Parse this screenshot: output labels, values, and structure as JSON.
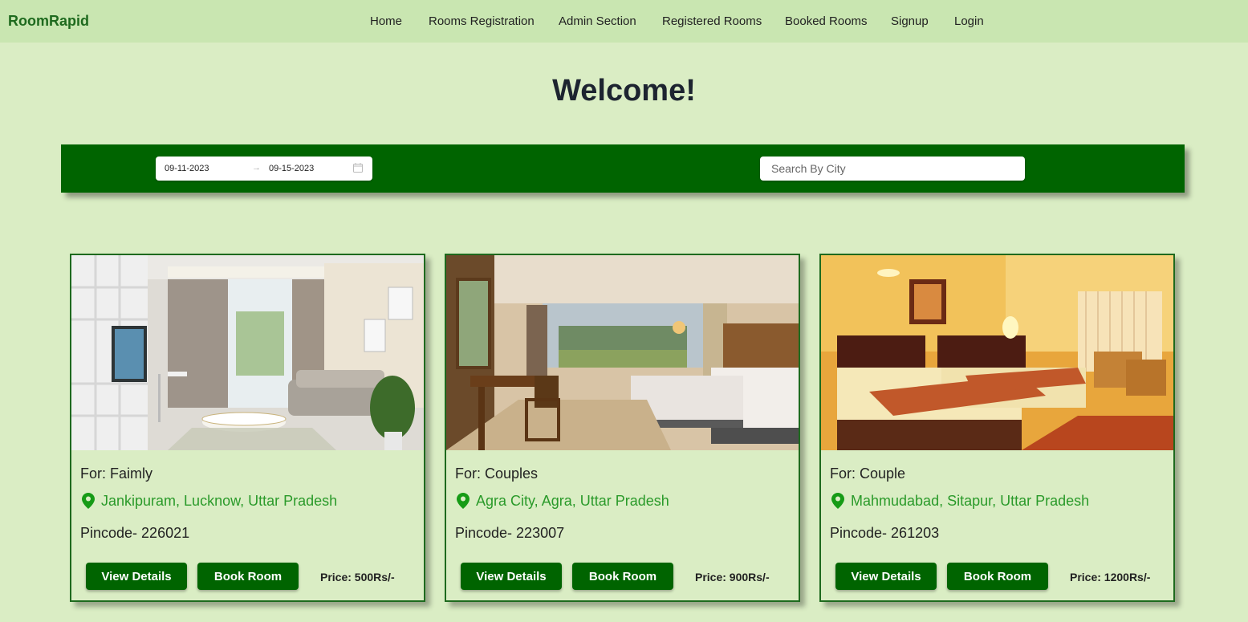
{
  "nav": {
    "brand": "RoomRapid",
    "items": [
      "Home",
      "Rooms Registration",
      "Admin Section",
      "Registered Rooms",
      "Booked Rooms",
      "Signup",
      "Login"
    ]
  },
  "welcome": "Welcome!",
  "search": {
    "start_date": "09-11-2023",
    "date_separator": "→",
    "end_date": "09-15-2023",
    "city_placeholder": "Search By City"
  },
  "cards": [
    {
      "for": "For: Faimly",
      "location": "Jankipuram, Lucknow, Uttar Pradesh",
      "pincode": "Pincode- 226021",
      "details_label": "View Details",
      "book_label": "Book Room",
      "price": "Price: 500Rs/-"
    },
    {
      "for": "For: Couples",
      "location": "Agra City, Agra, Uttar Pradesh",
      "pincode": "Pincode- 223007",
      "details_label": "View Details",
      "book_label": "Book Room",
      "price": "Price: 900Rs/-"
    },
    {
      "for": "For: Couple",
      "location": "Mahmudabad, Sitapur, Uttar Pradesh",
      "pincode": "Pincode- 261203",
      "details_label": "View Details",
      "book_label": "Book Room",
      "price": "Price: 1200Rs/-"
    }
  ],
  "colors": {
    "background": "#daedc4",
    "navbar": "#c9e6b1",
    "brand": "#1e6a1e",
    "accent": "#006400",
    "location_text": "#2a9a2a"
  }
}
